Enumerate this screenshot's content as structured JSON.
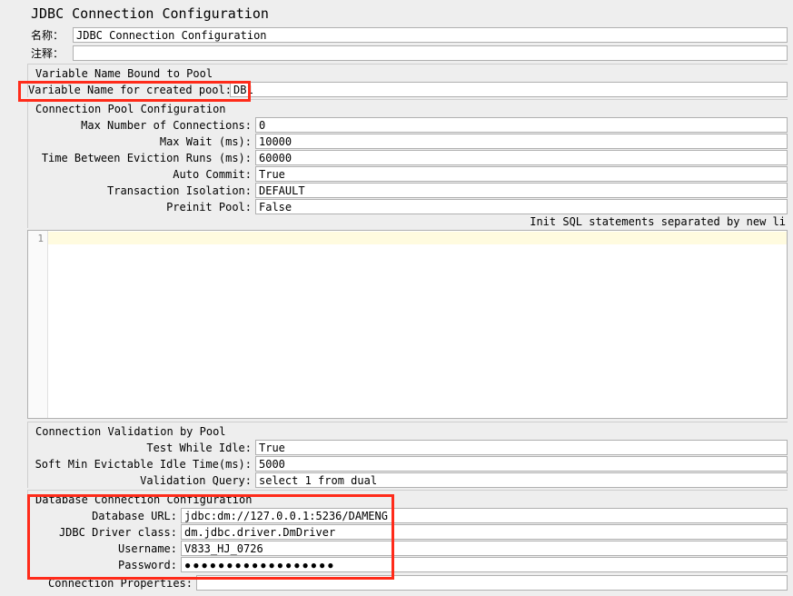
{
  "title": "JDBC Connection Configuration",
  "name_label": "名称：",
  "name_value": "JDBC Connection Configuration",
  "comment_label": "注释：",
  "comment_value": "",
  "sections": {
    "var_pool": {
      "title": "Variable Name Bound to Pool",
      "var_name_label": "Variable Name for created pool:",
      "var_name_value": "DB1"
    },
    "conn_pool": {
      "title": "Connection Pool Configuration",
      "max_conn_label": "Max Number of Connections:",
      "max_conn_value": "0",
      "max_wait_label": "Max Wait (ms):",
      "max_wait_value": "10000",
      "evict_label": "Time Between Eviction Runs (ms):",
      "evict_value": "60000",
      "auto_commit_label": "Auto Commit:",
      "auto_commit_value": "True",
      "tx_iso_label": "Transaction Isolation:",
      "tx_iso_value": "DEFAULT",
      "preinit_label": "Preinit Pool:",
      "preinit_value": "False",
      "init_sql_hint": "Init SQL statements separated by new li",
      "editor_line_no": "1"
    },
    "validation": {
      "title": "Connection Validation by Pool",
      "test_idle_label": "Test While Idle:",
      "test_idle_value": "True",
      "soft_min_label": "Soft Min Evictable Idle Time(ms):",
      "soft_min_value": "5000",
      "val_query_label": "Validation Query:",
      "val_query_value": "select 1 from dual"
    },
    "db_conn": {
      "title": "Database Connection Configuration",
      "url_label": "Database URL:",
      "url_value": "jdbc:dm://127.0.0.1:5236/DAMENG",
      "driver_label": "JDBC Driver class:",
      "driver_value": "dm.jdbc.driver.DmDriver",
      "user_label": "Username:",
      "user_value": "V833_HJ_0726",
      "pass_label": "Password:",
      "pass_value": "●●●●●●●●●●●●●●●●●●"
    },
    "conn_props": {
      "label": "Connection Properties:",
      "value": ""
    }
  }
}
